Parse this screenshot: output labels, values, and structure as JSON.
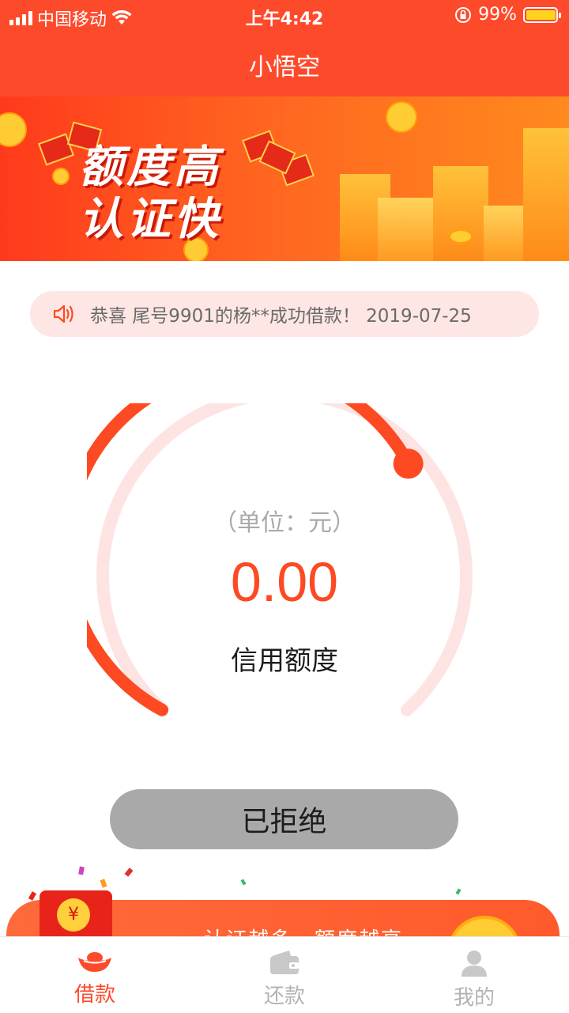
{
  "status_bar": {
    "carrier": "中国移动",
    "time": "上午4:42",
    "battery": "99%"
  },
  "nav": {
    "title": "小悟空"
  },
  "banner": {
    "line1": "额度高",
    "line2": "认证快"
  },
  "notice": {
    "text": "恭喜 尾号9901的杨**成功借款！ 2019-07-25"
  },
  "credit": {
    "unit": "（单位：元）",
    "amount": "0.00",
    "label": "信用额度"
  },
  "action": {
    "label": "已拒绝"
  },
  "promo": {
    "text": "认证越多，额度越高",
    "coin_symbol": "¥"
  },
  "tabs": [
    {
      "label": "借款",
      "icon": "ingot-icon",
      "active": true
    },
    {
      "label": "还款",
      "icon": "wallet-icon",
      "active": false
    },
    {
      "label": "我的",
      "icon": "person-icon",
      "active": false
    }
  ],
  "colors": {
    "brand": "#fd4a2b",
    "track": "#fde4e2",
    "button_disabled": "#a9a9a9",
    "tab_inactive": "#b3b3b3"
  }
}
